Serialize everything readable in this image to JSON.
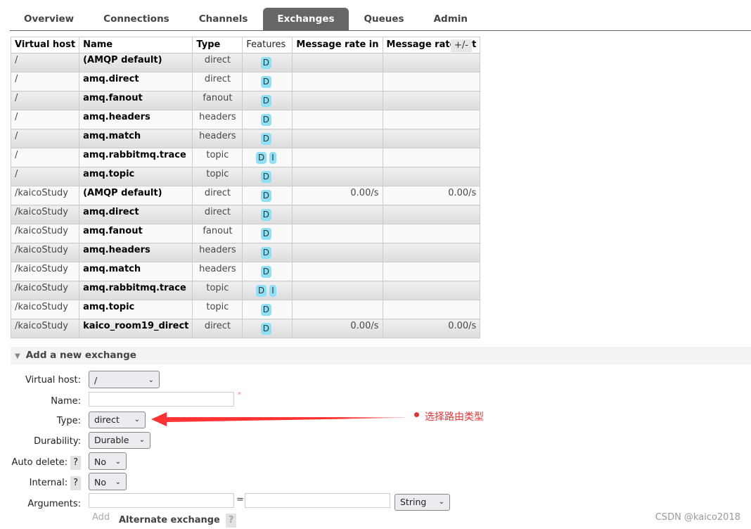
{
  "tabs": [
    "Overview",
    "Connections",
    "Channels",
    "Exchanges",
    "Queues",
    "Admin"
  ],
  "active_tab": "Exchanges",
  "table": {
    "headers": [
      "Virtual host",
      "Name",
      "Type",
      "Features",
      "Message rate in",
      "Message rate out"
    ],
    "toggle_columns": "+/-",
    "rows": [
      {
        "vhost": "/",
        "name": "(AMQP default)",
        "type": "direct",
        "features": [
          "D"
        ],
        "rate_in": "",
        "rate_out": ""
      },
      {
        "vhost": "/",
        "name": "amq.direct",
        "type": "direct",
        "features": [
          "D"
        ],
        "rate_in": "",
        "rate_out": ""
      },
      {
        "vhost": "/",
        "name": "amq.fanout",
        "type": "fanout",
        "features": [
          "D"
        ],
        "rate_in": "",
        "rate_out": ""
      },
      {
        "vhost": "/",
        "name": "amq.headers",
        "type": "headers",
        "features": [
          "D"
        ],
        "rate_in": "",
        "rate_out": ""
      },
      {
        "vhost": "/",
        "name": "amq.match",
        "type": "headers",
        "features": [
          "D"
        ],
        "rate_in": "",
        "rate_out": ""
      },
      {
        "vhost": "/",
        "name": "amq.rabbitmq.trace",
        "type": "topic",
        "features": [
          "D",
          "I"
        ],
        "rate_in": "",
        "rate_out": ""
      },
      {
        "vhost": "/",
        "name": "amq.topic",
        "type": "topic",
        "features": [
          "D"
        ],
        "rate_in": "",
        "rate_out": ""
      },
      {
        "vhost": "/kaicoStudy",
        "name": "(AMQP default)",
        "type": "direct",
        "features": [
          "D"
        ],
        "rate_in": "0.00/s",
        "rate_out": "0.00/s"
      },
      {
        "vhost": "/kaicoStudy",
        "name": "amq.direct",
        "type": "direct",
        "features": [
          "D"
        ],
        "rate_in": "",
        "rate_out": ""
      },
      {
        "vhost": "/kaicoStudy",
        "name": "amq.fanout",
        "type": "fanout",
        "features": [
          "D"
        ],
        "rate_in": "",
        "rate_out": ""
      },
      {
        "vhost": "/kaicoStudy",
        "name": "amq.headers",
        "type": "headers",
        "features": [
          "D"
        ],
        "rate_in": "",
        "rate_out": ""
      },
      {
        "vhost": "/kaicoStudy",
        "name": "amq.match",
        "type": "headers",
        "features": [
          "D"
        ],
        "rate_in": "",
        "rate_out": ""
      },
      {
        "vhost": "/kaicoStudy",
        "name": "amq.rabbitmq.trace",
        "type": "topic",
        "features": [
          "D",
          "I"
        ],
        "rate_in": "",
        "rate_out": ""
      },
      {
        "vhost": "/kaicoStudy",
        "name": "amq.topic",
        "type": "topic",
        "features": [
          "D"
        ],
        "rate_in": "",
        "rate_out": ""
      },
      {
        "vhost": "/kaicoStudy",
        "name": "kaico_room19_direct",
        "type": "direct",
        "features": [
          "D"
        ],
        "rate_in": "0.00/s",
        "rate_out": "0.00/s"
      }
    ]
  },
  "form": {
    "section_title": "Add a new exchange",
    "virtual_host_label": "Virtual host:",
    "virtual_host_value": "/",
    "name_label": "Name:",
    "name_value": "",
    "required_mark": "*",
    "type_label": "Type:",
    "type_value": "direct",
    "durability_label": "Durability:",
    "durability_value": "Durable",
    "auto_delete_label": "Auto delete:",
    "auto_delete_value": "No",
    "internal_label": "Internal:",
    "internal_value": "No",
    "arguments_label": "Arguments:",
    "arguments_eq": "=",
    "arguments_type": "String",
    "help": "?",
    "add_label": "Add",
    "alternate_exchange": "Alternate exchange"
  },
  "annotation": {
    "text": "选择路由类型",
    "color": "#e53333"
  },
  "watermark": "CSDN @kaico2018"
}
